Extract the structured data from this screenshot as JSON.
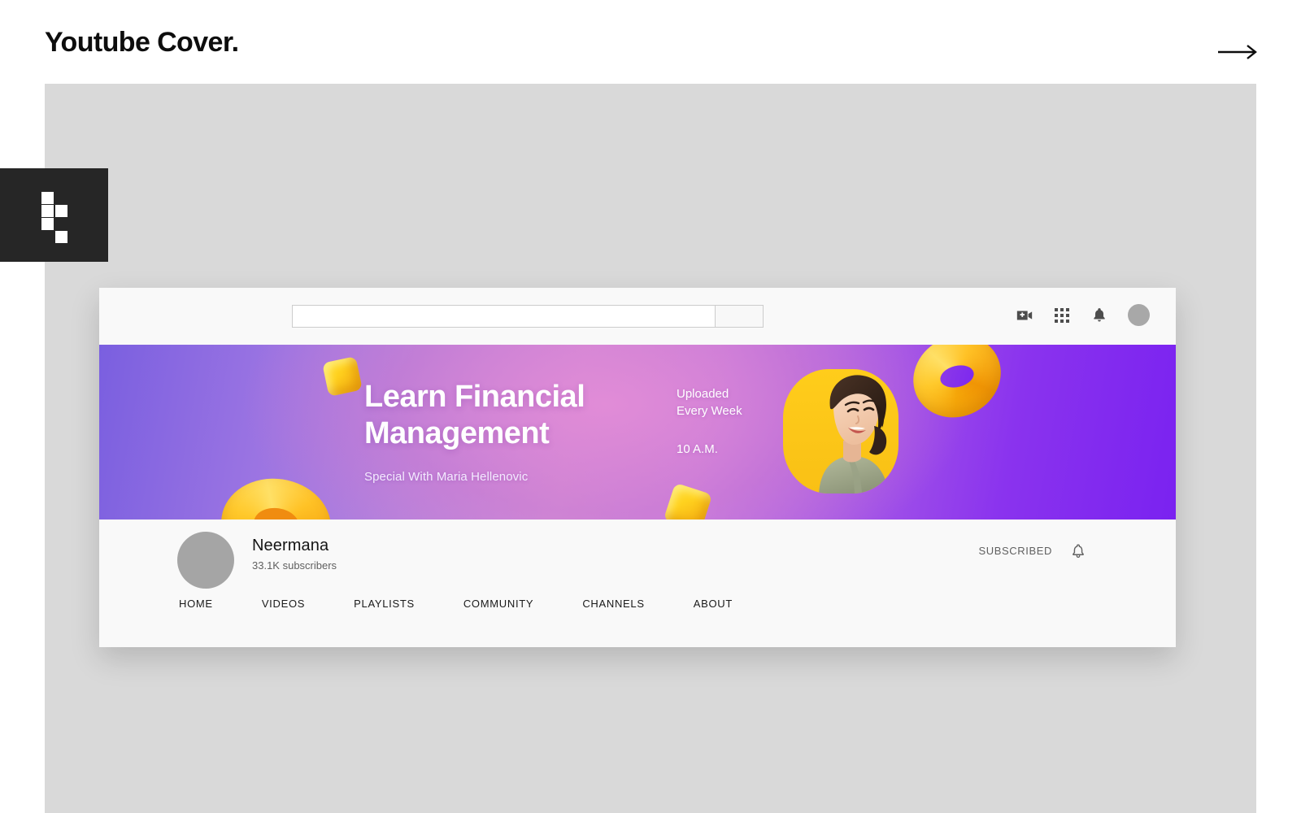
{
  "page": {
    "title": "Youtube Cover.",
    "next_arrow_icon": "arrow-right-icon",
    "logo_icon": "pixel-block-logo-icon"
  },
  "browser": {
    "search": {
      "value": "",
      "placeholder": "",
      "search_icon": "search-icon"
    },
    "icons": [
      {
        "name": "video-add-icon",
        "label": "Create video"
      },
      {
        "name": "apps-grid-icon",
        "label": "YouTube apps"
      },
      {
        "name": "bell-icon",
        "label": "Notifications"
      }
    ],
    "avatar_icon": "account-avatar"
  },
  "banner": {
    "title": "Learn Financial\nManagement",
    "subtitle": "Special With Maria Hellenovic",
    "schedule": "Uploaded\nEvery Week",
    "time": "10 A.M.",
    "portrait_alt": "Smiling woman portrait",
    "colors": {
      "gradient_start": "#7a5fe0",
      "gradient_mid": "#cf8ed8",
      "gradient_end": "#7a22f0",
      "accent_yellow": "#ffc91f",
      "accent_orange": "#f0960a",
      "text": "#ffffff"
    },
    "decorations": [
      {
        "name": "cube-decoration",
        "shape": "cube"
      },
      {
        "name": "cube-decoration",
        "shape": "cube"
      },
      {
        "name": "torus-decoration",
        "shape": "torus"
      },
      {
        "name": "torus-decoration",
        "shape": "torus"
      }
    ]
  },
  "channel": {
    "name": "Neermana",
    "subscribers": "33.1K subscribers",
    "subscribed_label": "SUBSCRIBED",
    "bell_icon": "bell-outline-icon",
    "avatar_icon": "channel-avatar",
    "tabs": [
      {
        "label": "HOME"
      },
      {
        "label": "VIDEOS"
      },
      {
        "label": "PLAYLISTS"
      },
      {
        "label": "COMMUNITY"
      },
      {
        "label": "CHANNELS"
      },
      {
        "label": "ABOUT"
      }
    ]
  }
}
